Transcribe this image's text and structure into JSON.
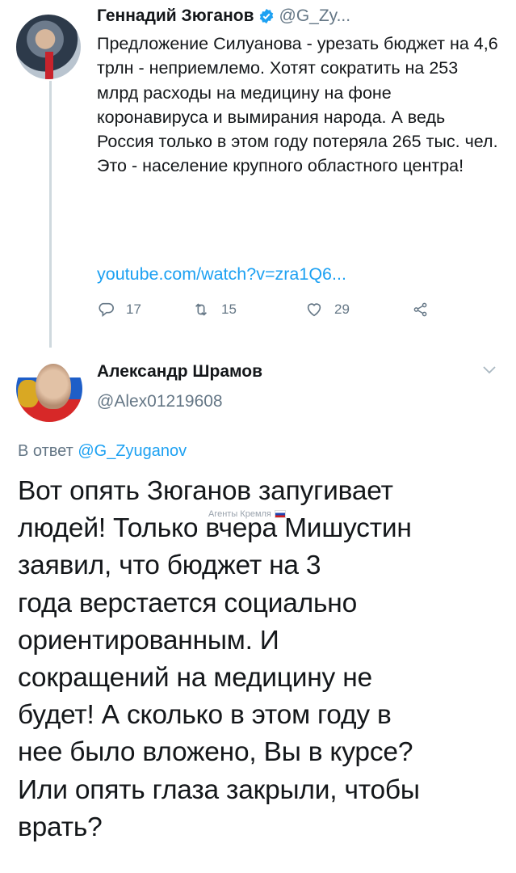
{
  "tweet1": {
    "author_name": "Геннадий Зюганов",
    "author_handle": "@G_Zy...",
    "text": "Предложение Силуанова - урезать бюджет на 4,6 трлн - неприемлемо. Хотят сократить на 253 млрд расходы на медицину на фоне коронавируса и вымирания народа. А ведь Россия только в этом году потеряла 265 тыс. чел. Это - население крупного областного центра!",
    "link": "youtube.com/watch?v=zra1Q6...",
    "replies": "17",
    "retweets": "15",
    "likes": "29",
    "accent_color": "#1da1f2"
  },
  "tweet2": {
    "author_name": "Александр Шрамов",
    "author_handle": "@Alex01219608",
    "reply_prefix": "В ответ ",
    "reply_handle": "@G_Zyuganov",
    "lines": [
      "Вот опять Зюганов запугивает",
      "людей! Только вчера Мишустин",
      "заявил, что бюджет на 3",
      "года верстается социально",
      "ориентированным. И",
      "сокращений на медицину не",
      "будет! А сколько в этом году в",
      "нее было вложено, Вы в курсе?",
      "Или опять глаза закрыли, чтобы",
      "врать?"
    ]
  },
  "watermark": "Агенты Кремля"
}
